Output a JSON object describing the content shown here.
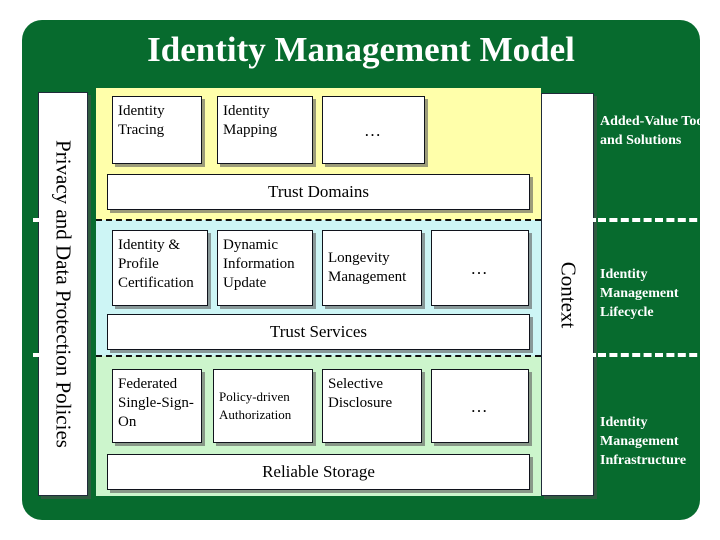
{
  "title": "Identity Management Model",
  "left_axis": {
    "label": "Privacy and Data Protection Policies"
  },
  "right_axis": {
    "label": "Context"
  },
  "colors": {
    "frame_green": "#076b2e",
    "band_added_value": "#ffffaa",
    "band_lifecycle": "#cdf5f5",
    "band_infrastructure": "#ccf5cc",
    "box_fill": "#ffffff",
    "title_text": "#ffffff"
  },
  "layers": [
    {
      "id": "added-value-tools-and-solutions",
      "right_label": "Added-Value Tools and Solutions",
      "boxes": [
        {
          "text": "Identity Tracing",
          "style": "top"
        },
        {
          "text": "Identity Mapping",
          "style": "top"
        },
        {
          "text": "…",
          "style": "ellipsis"
        }
      ],
      "bar": "Trust Domains"
    },
    {
      "id": "identity-management-lifecycle",
      "right_label": "Identity Management Lifecycle",
      "boxes": [
        {
          "text": "Identity & Profile Certification",
          "style": "top"
        },
        {
          "text": "Dynamic Information Update",
          "style": "top"
        },
        {
          "text": "Longevity Management",
          "style": "middle"
        },
        {
          "text": "…",
          "style": "ellipsis"
        }
      ],
      "bar": "Trust Services"
    },
    {
      "id": "identity-management-infrastructure",
      "right_label": "Identity Management Infrastructure",
      "boxes": [
        {
          "text": "Federated Single-Sign-On",
          "style": "top"
        },
        {
          "text": "Policy-driven Authorization",
          "style": "small"
        },
        {
          "text": "Selective Disclosure",
          "style": "top"
        },
        {
          "text": "…",
          "style": "ellipsis"
        }
      ],
      "bar": "Reliable Storage"
    }
  ]
}
